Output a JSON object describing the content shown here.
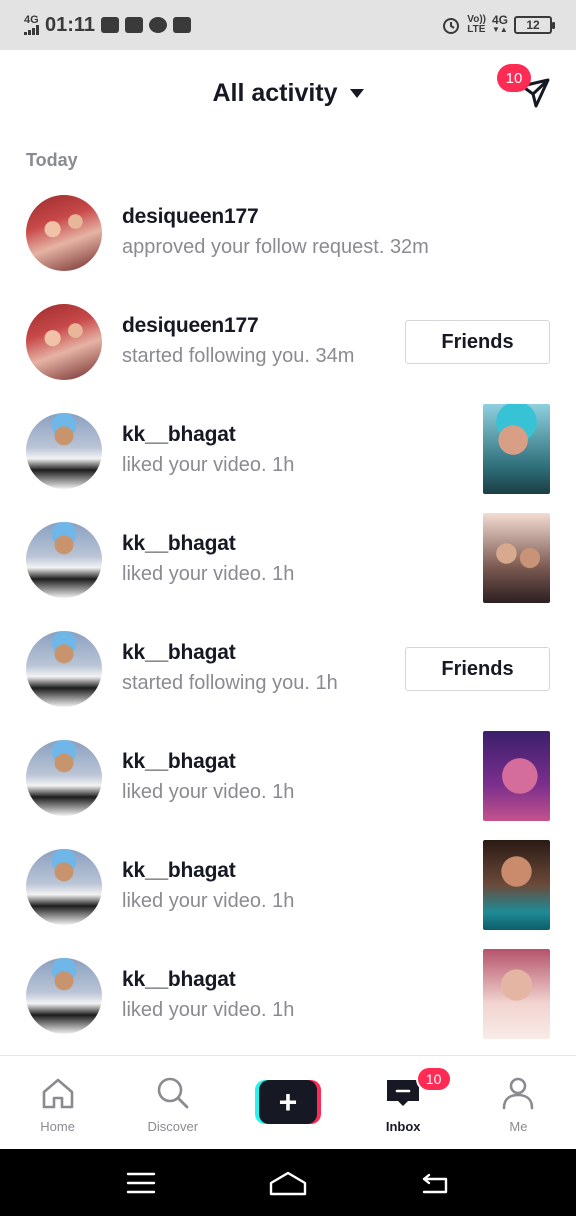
{
  "status_bar": {
    "network": "4G",
    "time": "01:11",
    "volte_top": "Vo))",
    "volte_bottom": "LTE",
    "net2": "4G",
    "battery": "12"
  },
  "header": {
    "title": "All activity",
    "inbox_badge": "10"
  },
  "section": "Today",
  "notifications": [
    {
      "user": "desiqueen177",
      "text": "approved your follow request.",
      "time": "32m",
      "avatar": "couple",
      "action": "none"
    },
    {
      "user": "desiqueen177",
      "text": "started following you.",
      "time": "34m",
      "avatar": "couple",
      "action": "friends"
    },
    {
      "user": "kk__bhagat",
      "text": "liked your video.",
      "time": "1h",
      "avatar": "man",
      "action": "thumb"
    },
    {
      "user": "kk__bhagat",
      "text": "liked your video.",
      "time": "1h",
      "avatar": "man",
      "action": "thumb"
    },
    {
      "user": "kk__bhagat",
      "text": "started following you.",
      "time": "1h",
      "avatar": "man",
      "action": "friends"
    },
    {
      "user": "kk__bhagat",
      "text": "liked your video.",
      "time": "1h",
      "avatar": "man",
      "action": "thumb"
    },
    {
      "user": "kk__bhagat",
      "text": "liked your video.",
      "time": "1h",
      "avatar": "man",
      "action": "thumb"
    },
    {
      "user": "kk__bhagat",
      "text": "liked your video.",
      "time": "1h",
      "avatar": "man",
      "action": "thumb"
    }
  ],
  "friends_label": "Friends",
  "bottom_nav": {
    "home": "Home",
    "discover": "Discover",
    "create": "+",
    "inbox": "Inbox",
    "inbox_badge": "10",
    "me": "Me"
  },
  "colors": {
    "accent": "#fe2c55",
    "cyan": "#25f4ee",
    "text": "#161823",
    "muted": "#8a8b91"
  }
}
